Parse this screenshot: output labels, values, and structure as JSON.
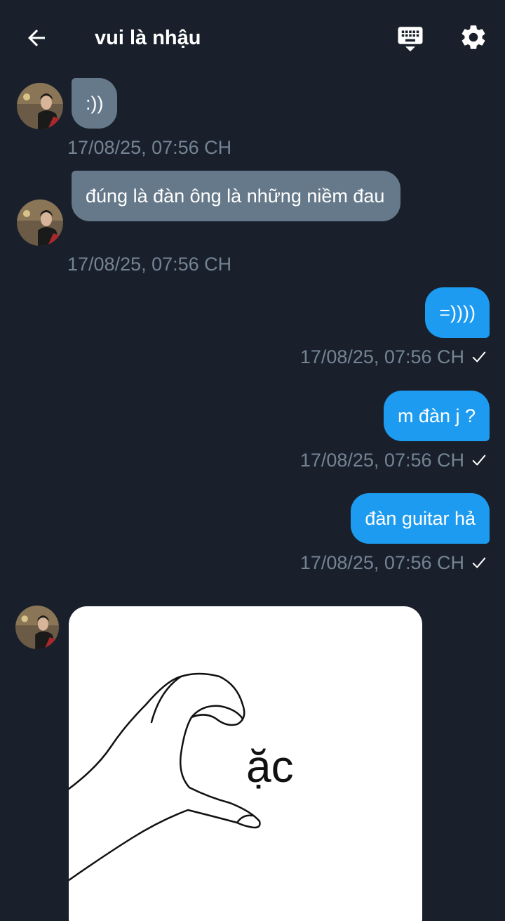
{
  "header": {
    "title": "vui là nhậu",
    "back_icon": "arrow-left-icon",
    "keyboard_icon": "keyboard-icon",
    "settings_icon": "gear-icon"
  },
  "messages": [
    {
      "direction": "incoming",
      "text": ":))",
      "timestamp": "17/08/25, 07:56 CH"
    },
    {
      "direction": "incoming",
      "text": "đúng là đàn ông là những niềm đau",
      "timestamp": "17/08/25, 07:56 CH"
    },
    {
      "direction": "outgoing",
      "text": "=))))",
      "timestamp": "17/08/25, 07:56 CH",
      "status_icon": "check-icon"
    },
    {
      "direction": "outgoing",
      "text": "m đàn j ?",
      "timestamp": "17/08/25, 07:56 CH",
      "status_icon": "check-icon"
    },
    {
      "direction": "outgoing",
      "text": "đàn guitar hả",
      "timestamp": "17/08/25, 07:56 CH",
      "status_icon": "check-icon"
    },
    {
      "direction": "incoming",
      "type": "image",
      "image_text": "ặc"
    }
  ],
  "colors": {
    "background": "#19202b",
    "incoming_bubble": "#66798a",
    "outgoing_bubble": "#1d9bf0",
    "timestamp": "#748494"
  }
}
